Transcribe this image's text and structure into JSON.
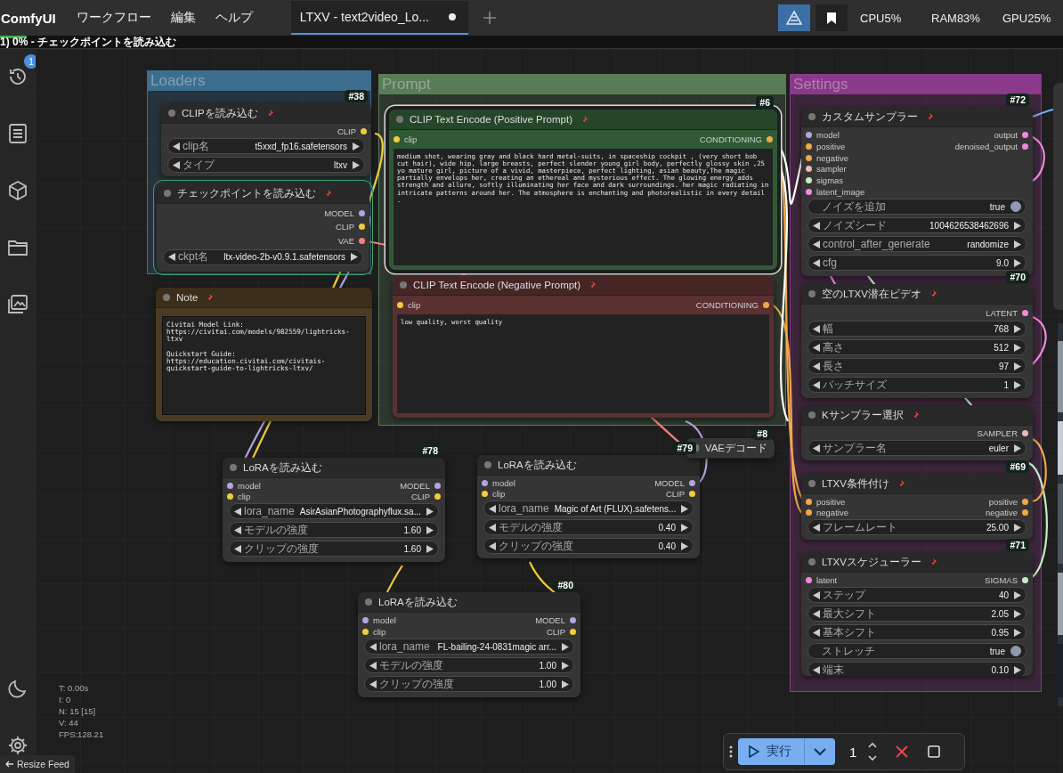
{
  "menubar": {
    "logo": "ComfyUI",
    "menus": [
      "ワークフロー",
      "編集",
      "ヘルプ"
    ],
    "tabs": [
      {
        "label": "LTXV - text2video_Lo...",
        "selected": true,
        "unsaved": true
      }
    ]
  },
  "stats": [
    "CPU5%",
    "RAM83%",
    "GPU25%"
  ],
  "progress": {
    "text": "1) 0% - チェックポイントを読み込む",
    "level": 0.025
  },
  "sidebar": {
    "items": [
      {
        "kind": "history",
        "badge": "1"
      },
      {
        "kind": "document"
      },
      {
        "kind": "cube"
      },
      {
        "kind": "folder"
      },
      {
        "kind": "images"
      }
    ],
    "bottom": [
      {
        "kind": "theme"
      },
      {
        "kind": "settings"
      }
    ]
  },
  "groups": [
    {
      "title": "Loaders",
      "color": "#3d6e8f"
    },
    {
      "title": "Prompt",
      "color": "#587c58"
    },
    {
      "title": "Settings",
      "color": "#8a3a88"
    }
  ],
  "nodes": [
    {
      "id": "#38",
      "title": "CLIPを読み込む",
      "color": "#353535",
      "pinned": true,
      "selected": false,
      "executing": false,
      "collapsed": false,
      "outputs": [
        {
          "name": "CLIP",
          "color": "#f2cc3c"
        }
      ],
      "widgets": [
        {
          "kind": "combo",
          "label": "clip名",
          "value": "t5xxd_fp16.safetensors"
        },
        {
          "kind": "combo",
          "label": "タイプ",
          "value": "ltxv"
        }
      ]
    },
    {
      "title": "チェックポイントを読み込む",
      "color": "#353535",
      "pinned": true,
      "selected": false,
      "executing": true,
      "collapsed": false,
      "outputs": [
        {
          "name": "MODEL",
          "color": "#b4a4e0"
        },
        {
          "name": "CLIP",
          "color": "#f2cc3c"
        },
        {
          "name": "VAE",
          "color": "#f08080"
        }
      ],
      "widgets": [
        {
          "kind": "combo",
          "label": "ckpt名",
          "value": "ltx-video-2b-v0.9.1.safetensors"
        }
      ]
    },
    {
      "title": "Note",
      "color": "#4b3b22",
      "pinned": true,
      "selected": false,
      "executing": false,
      "collapsed": false,
      "text": "Civitai Model Link:\nhttps://civitai.com/models/982559/lightricks-ltxv\n\nQuickstart Guide: https://education.civitai.com/civitais-quickstart-guide-to-lightricks-ltxv/"
    },
    {
      "id": "#6",
      "title": "CLIP Text Encode (Positive Prompt)",
      "color": "#2f5a35",
      "pinned": true,
      "selected": true,
      "executing": false,
      "collapsed": false,
      "inputs": [
        {
          "name": "clip",
          "color": "#f2cc3c"
        }
      ],
      "outputs": [
        {
          "name": "CONDITIONING",
          "color": "#f0a848"
        }
      ],
      "text": "medium shot, wearing gray and black hard metal-suits, in spaceship cockpit , (very short bob cut hair), wide hip, large breasts, perfect slender young girl body, perfectly glossy skin ,25 yo mature girl, picture of a vivid, masterpiece, perfect lighting, asian beauty,The magic partially envelops her, creating an ethereal and mysterious effect. The glowing energy adds strength and allure, softly illuminating her face and dark surroundings. her magic radiating in intricate patterns around her. The atmosphere is enchanting and photorealistic in every detail ."
    },
    {
      "title": "CLIP Text Encode (Negative Prompt)",
      "color": "#5a3030",
      "pinned": true,
      "selected": false,
      "executing": false,
      "collapsed": false,
      "inputs": [
        {
          "name": "clip",
          "color": "#f2cc3c"
        }
      ],
      "outputs": [
        {
          "name": "CONDITIONING",
          "color": "#f0a848"
        }
      ],
      "text": "low quality, worst quality"
    },
    {
      "id": "#72",
      "title": "カスタムサンプラー",
      "color": "#353535",
      "pinned": true,
      "selected": false,
      "executing": false,
      "collapsed": false,
      "inputs": [
        {
          "name": "model",
          "color": "#b4a4e0"
        },
        {
          "name": "positive",
          "color": "#f0a848"
        },
        {
          "name": "negative",
          "color": "#f0a848"
        },
        {
          "name": "sampler",
          "color": "#ecb8b8"
        },
        {
          "name": "sigmas",
          "color": "#c4ecc4"
        },
        {
          "name": "latent_image",
          "color": "#f088e0"
        }
      ],
      "outputs": [
        {
          "name": "output",
          "color": "#f088e0"
        },
        {
          "name": "denoised_output",
          "color": "#f088e0"
        }
      ],
      "widgets": [
        {
          "kind": "toggle",
          "label": "ノイズを追加",
          "value": "true",
          "on": true
        },
        {
          "kind": "combo",
          "label": "ノイズシード",
          "value": "1004626538462696"
        },
        {
          "kind": "combo",
          "label": "control_after_generate",
          "value": "randomize"
        },
        {
          "kind": "combo",
          "label": "cfg",
          "value": "9.0"
        }
      ]
    },
    {
      "id": "#70",
      "title": "空のLTXV潜在ビデオ",
      "color": "#353535",
      "pinned": true,
      "selected": false,
      "executing": false,
      "collapsed": false,
      "outputs": [
        {
          "name": "LATENT",
          "color": "#f088e0"
        }
      ],
      "widgets": [
        {
          "kind": "combo",
          "label": "幅",
          "value": "768"
        },
        {
          "kind": "combo",
          "label": "高さ",
          "value": "512"
        },
        {
          "kind": "combo",
          "label": "長さ",
          "value": "97"
        },
        {
          "kind": "combo",
          "label": "バッチサイズ",
          "value": "1"
        }
      ]
    },
    {
      "title": "Kサンプラー選択",
      "color": "#353535",
      "pinned": true,
      "selected": false,
      "executing": false,
      "collapsed": false,
      "outputs": [
        {
          "name": "SAMPLER",
          "color": "#ecb8b8"
        }
      ],
      "widgets": [
        {
          "kind": "combo",
          "label": "サンプラー名",
          "value": "euler"
        }
      ]
    },
    {
      "id": "#69",
      "title": "LTXV条件付け",
      "color": "#353535",
      "pinned": true,
      "selected": false,
      "executing": false,
      "collapsed": false,
      "inputs": [
        {
          "name": "positive",
          "color": "#f0a848"
        },
        {
          "name": "negative",
          "color": "#f0a848"
        }
      ],
      "outputs": [
        {
          "name": "positive",
          "color": "#f0a848"
        },
        {
          "name": "negative",
          "color": "#f0a848"
        }
      ],
      "widgets": [
        {
          "kind": "combo",
          "label": "フレームレート",
          "value": "25.00"
        }
      ]
    },
    {
      "id": "#71",
      "title": "LTXVスケジューラー",
      "color": "#353535",
      "pinned": true,
      "selected": false,
      "executing": false,
      "collapsed": false,
      "inputs": [
        {
          "name": "latent",
          "color": "#f088e0"
        }
      ],
      "outputs": [
        {
          "name": "SIGMAS",
          "color": "#c4ecc4"
        }
      ],
      "widgets": [
        {
          "kind": "combo",
          "label": "ステップ",
          "value": "40"
        },
        {
          "kind": "combo",
          "label": "最大シフト",
          "value": "2.05"
        },
        {
          "kind": "combo",
          "label": "基本シフト",
          "value": "0.95"
        },
        {
          "kind": "toggle",
          "label": "ストレッチ",
          "value": "true",
          "on": true
        },
        {
          "kind": "combo",
          "label": "端末",
          "value": "0.10"
        }
      ]
    },
    {
      "id": "#78",
      "title": "LoRAを読み込む",
      "color": "#353535",
      "pinned": false,
      "selected": false,
      "executing": false,
      "collapsed": false,
      "inputs": [
        {
          "name": "model",
          "color": "#b4a4e0"
        },
        {
          "name": "clip",
          "color": "#f2cc3c"
        }
      ],
      "outputs": [
        {
          "name": "MODEL",
          "color": "#b4a4e0"
        },
        {
          "name": "CLIP",
          "color": "#f2cc3c"
        }
      ],
      "widgets": [
        {
          "kind": "combo",
          "label": "lora_name",
          "value": "AsirAsianPhotographyflux.sa..."
        },
        {
          "kind": "combo",
          "label": "モデルの強度",
          "value": "1.60"
        },
        {
          "kind": "combo",
          "label": "クリップの強度",
          "value": "1.60"
        }
      ]
    },
    {
      "id": "#79",
      "title": "LoRAを読み込む",
      "color": "#353535",
      "pinned": false,
      "selected": false,
      "executing": false,
      "collapsed": false,
      "inputs": [
        {
          "name": "model",
          "color": "#b4a4e0"
        },
        {
          "name": "clip",
          "color": "#f2cc3c"
        }
      ],
      "outputs": [
        {
          "name": "MODEL",
          "color": "#b4a4e0"
        },
        {
          "name": "CLIP",
          "color": "#f2cc3c"
        }
      ],
      "widgets": [
        {
          "kind": "combo",
          "label": "lora_name",
          "value": "Magic of Art (FLUX).safetens..."
        },
        {
          "kind": "combo",
          "label": "モデルの強度",
          "value": "0.40"
        },
        {
          "kind": "combo",
          "label": "クリップの強度",
          "value": "0.40"
        }
      ]
    },
    {
      "id": "#80",
      "title": "LoRAを読み込む",
      "color": "#353535",
      "pinned": false,
      "selected": false,
      "executing": false,
      "collapsed": false,
      "inputs": [
        {
          "name": "model",
          "color": "#b4a4e0"
        },
        {
          "name": "clip",
          "color": "#f2cc3c"
        }
      ],
      "outputs": [
        {
          "name": "MODEL",
          "color": "#b4a4e0"
        },
        {
          "name": "CLIP",
          "color": "#f2cc3c"
        }
      ],
      "widgets": [
        {
          "kind": "combo",
          "label": "lora_name",
          "value": "FL-bailing-24-0831magic arr..."
        },
        {
          "kind": "combo",
          "label": "モデルの強度",
          "value": "1.00"
        },
        {
          "kind": "combo",
          "label": "クリップの強度",
          "value": "1.00"
        }
      ]
    },
    {
      "id": "#8",
      "title": "VAEデコード",
      "color": "#353535",
      "pinned": false,
      "selected": false,
      "executing": false,
      "collapsed": true
    }
  ],
  "canvas_stats": [
    "T: 0.00s",
    "I: 0",
    "N: 15 [15]",
    "V: 44",
    "FPS:128.21"
  ],
  "run_bar": {
    "run_label": "実行",
    "count": "1"
  },
  "feed": {
    "label": "Resize Feed"
  }
}
